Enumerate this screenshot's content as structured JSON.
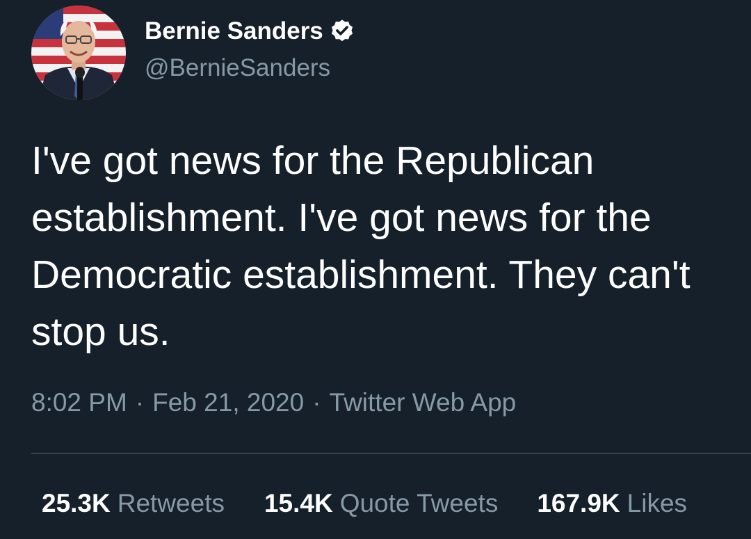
{
  "author": {
    "display_name": "Bernie Sanders",
    "handle": "@BernieSanders",
    "verified": true,
    "avatar_icon": "profile-photo",
    "verified_icon": "verified-badge-icon"
  },
  "tweet": {
    "text_lines": [
      "I've got news for the Republican",
      "establishment. I've got news for the",
      "Democratic establishment. They can't",
      "stop us."
    ],
    "time": "8:02 PM",
    "date": "Feb 21, 2020",
    "source": "Twitter Web App",
    "separator": "·"
  },
  "stats": {
    "retweets": {
      "count": "25.3K",
      "label": "Retweets"
    },
    "quote_tweets": {
      "count": "15.4K",
      "label": "Quote Tweets"
    },
    "likes": {
      "count": "167.9K",
      "label": "Likes"
    }
  },
  "colors": {
    "background": "#15202b",
    "primary_text": "#ffffff",
    "secondary_text": "#8899a6",
    "divider": "#38444d"
  }
}
